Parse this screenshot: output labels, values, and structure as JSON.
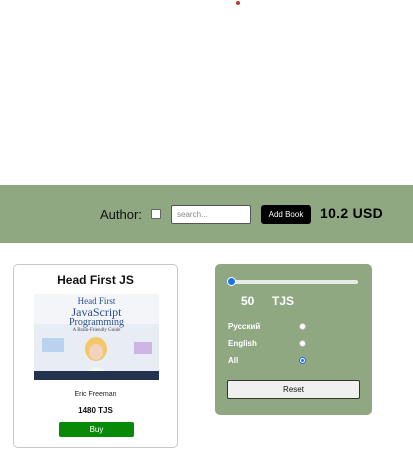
{
  "header": {
    "author_label": "Author:",
    "search_placeholder": "search...",
    "add_book_label": "Add Book",
    "total": "10.2 USD"
  },
  "book": {
    "title": "Head First JS",
    "cover_lines": [
      "Head First",
      "JavaScript",
      "Programming",
      "A Brain-Friendly Guide"
    ],
    "author": "Eric Freeman",
    "price": "1480 TJS",
    "buy_label": "Buy"
  },
  "filter": {
    "price_value": "50",
    "price_currency": "TJS",
    "slider_fraction": 0.0,
    "languages": [
      {
        "label": "Русский",
        "selected": false
      },
      {
        "label": "English",
        "selected": false
      },
      {
        "label": "All",
        "selected": true
      }
    ],
    "reset_label": "Reset"
  },
  "colors": {
    "panel_bg": "#8fa882",
    "buy_button": "#088a08",
    "accent": "#1a73e8"
  }
}
